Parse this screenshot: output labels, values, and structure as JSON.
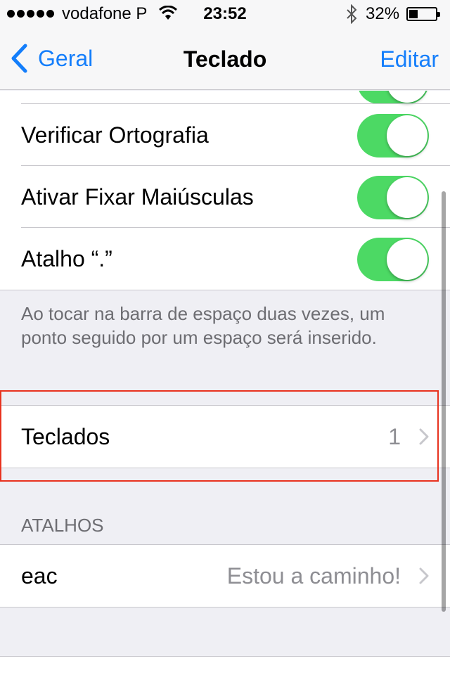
{
  "status_bar": {
    "carrier": "vodafone P",
    "time": "23:52",
    "battery_percent": "32%",
    "battery_level": 0.32,
    "signal_icon": "signal-dots-icon",
    "wifi_icon": "wifi-icon",
    "bluetooth_icon": "bluetooth-icon"
  },
  "nav_bar": {
    "back_label": "Geral",
    "title": "Teclado",
    "edit_label": "Editar"
  },
  "settings": {
    "partial_toggle_on": true,
    "rows": [
      {
        "label": "Verificar Ortografia",
        "on": true
      },
      {
        "label": "Ativar Fixar Maiúsculas",
        "on": true
      },
      {
        "label": "Atalho “.”",
        "on": true
      }
    ],
    "footer": "Ao tocar na barra de espaço duas vezes, um ponto seguido por um espaço será inserido."
  },
  "keyboards": {
    "label": "Teclados",
    "count": "1"
  },
  "shortcuts": {
    "header": "ATALHOS",
    "items": [
      {
        "shortcut": "eac",
        "phrase": "Estou a caminho!"
      }
    ]
  },
  "colors": {
    "accent": "#147efb",
    "toggle_on": "#4cd964",
    "highlight": "#e8321f",
    "background": "#efeff4"
  }
}
